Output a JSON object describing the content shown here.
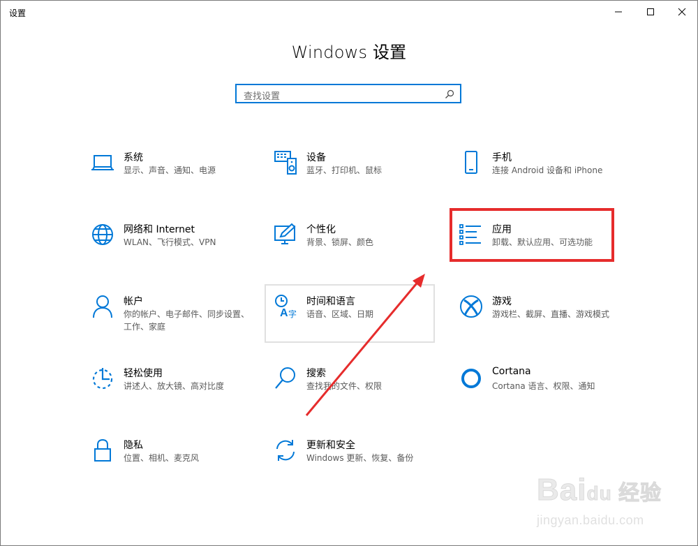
{
  "window": {
    "title": "设置",
    "caption": {
      "minimize": "minimize-icon",
      "maximize": "maximize-icon",
      "close": "close-icon"
    }
  },
  "header": {
    "heading": "Windows 设置"
  },
  "search": {
    "placeholder": "查找设置",
    "icon": "search-icon"
  },
  "tiles": [
    {
      "title": "系统",
      "desc": "显示、声音、通知、电源",
      "icon": "laptop-icon"
    },
    {
      "title": "设备",
      "desc": "蓝牙、打印机、鼠标",
      "icon": "devices-icon"
    },
    {
      "title": "手机",
      "desc": "连接 Android 设备和 iPhone",
      "icon": "phone-icon"
    },
    {
      "title": "网络和 Internet",
      "desc": "WLAN、飞行模式、VPN",
      "icon": "globe-icon"
    },
    {
      "title": "个性化",
      "desc": "背景、锁屏、颜色",
      "icon": "personalization-icon"
    },
    {
      "title": "应用",
      "desc": "卸载、默认应用、可选功能",
      "icon": "apps-list-icon"
    },
    {
      "title": "帐户",
      "desc": "你的帐户、电子邮件、同步设置、工作、家庭",
      "icon": "person-icon"
    },
    {
      "title": "时间和语言",
      "desc": "语音、区域、日期",
      "icon": "time-language-icon"
    },
    {
      "title": "游戏",
      "desc": "游戏栏、截屏、直播、游戏模式",
      "icon": "xbox-icon"
    },
    {
      "title": "轻松使用",
      "desc": "讲述人、放大镜、高对比度",
      "icon": "ease-of-access-icon"
    },
    {
      "title": "搜索",
      "desc": "查找我的文件、权限",
      "icon": "magnifier-icon"
    },
    {
      "title": "Cortana",
      "desc": "Cortana 语言、权限、通知",
      "icon": "cortana-ring-icon"
    },
    {
      "title": "隐私",
      "desc": "位置、相机、麦克风",
      "icon": "lock-icon"
    },
    {
      "title": "更新和安全",
      "desc": "Windows 更新、恢复、备份",
      "icon": "sync-arrows-icon"
    }
  ],
  "colors": {
    "accent": "#0078d7",
    "highlight": "#e62c2c"
  },
  "watermark": {
    "logo": "Bai du 经验",
    "url": "jingyan.baidu.com"
  }
}
